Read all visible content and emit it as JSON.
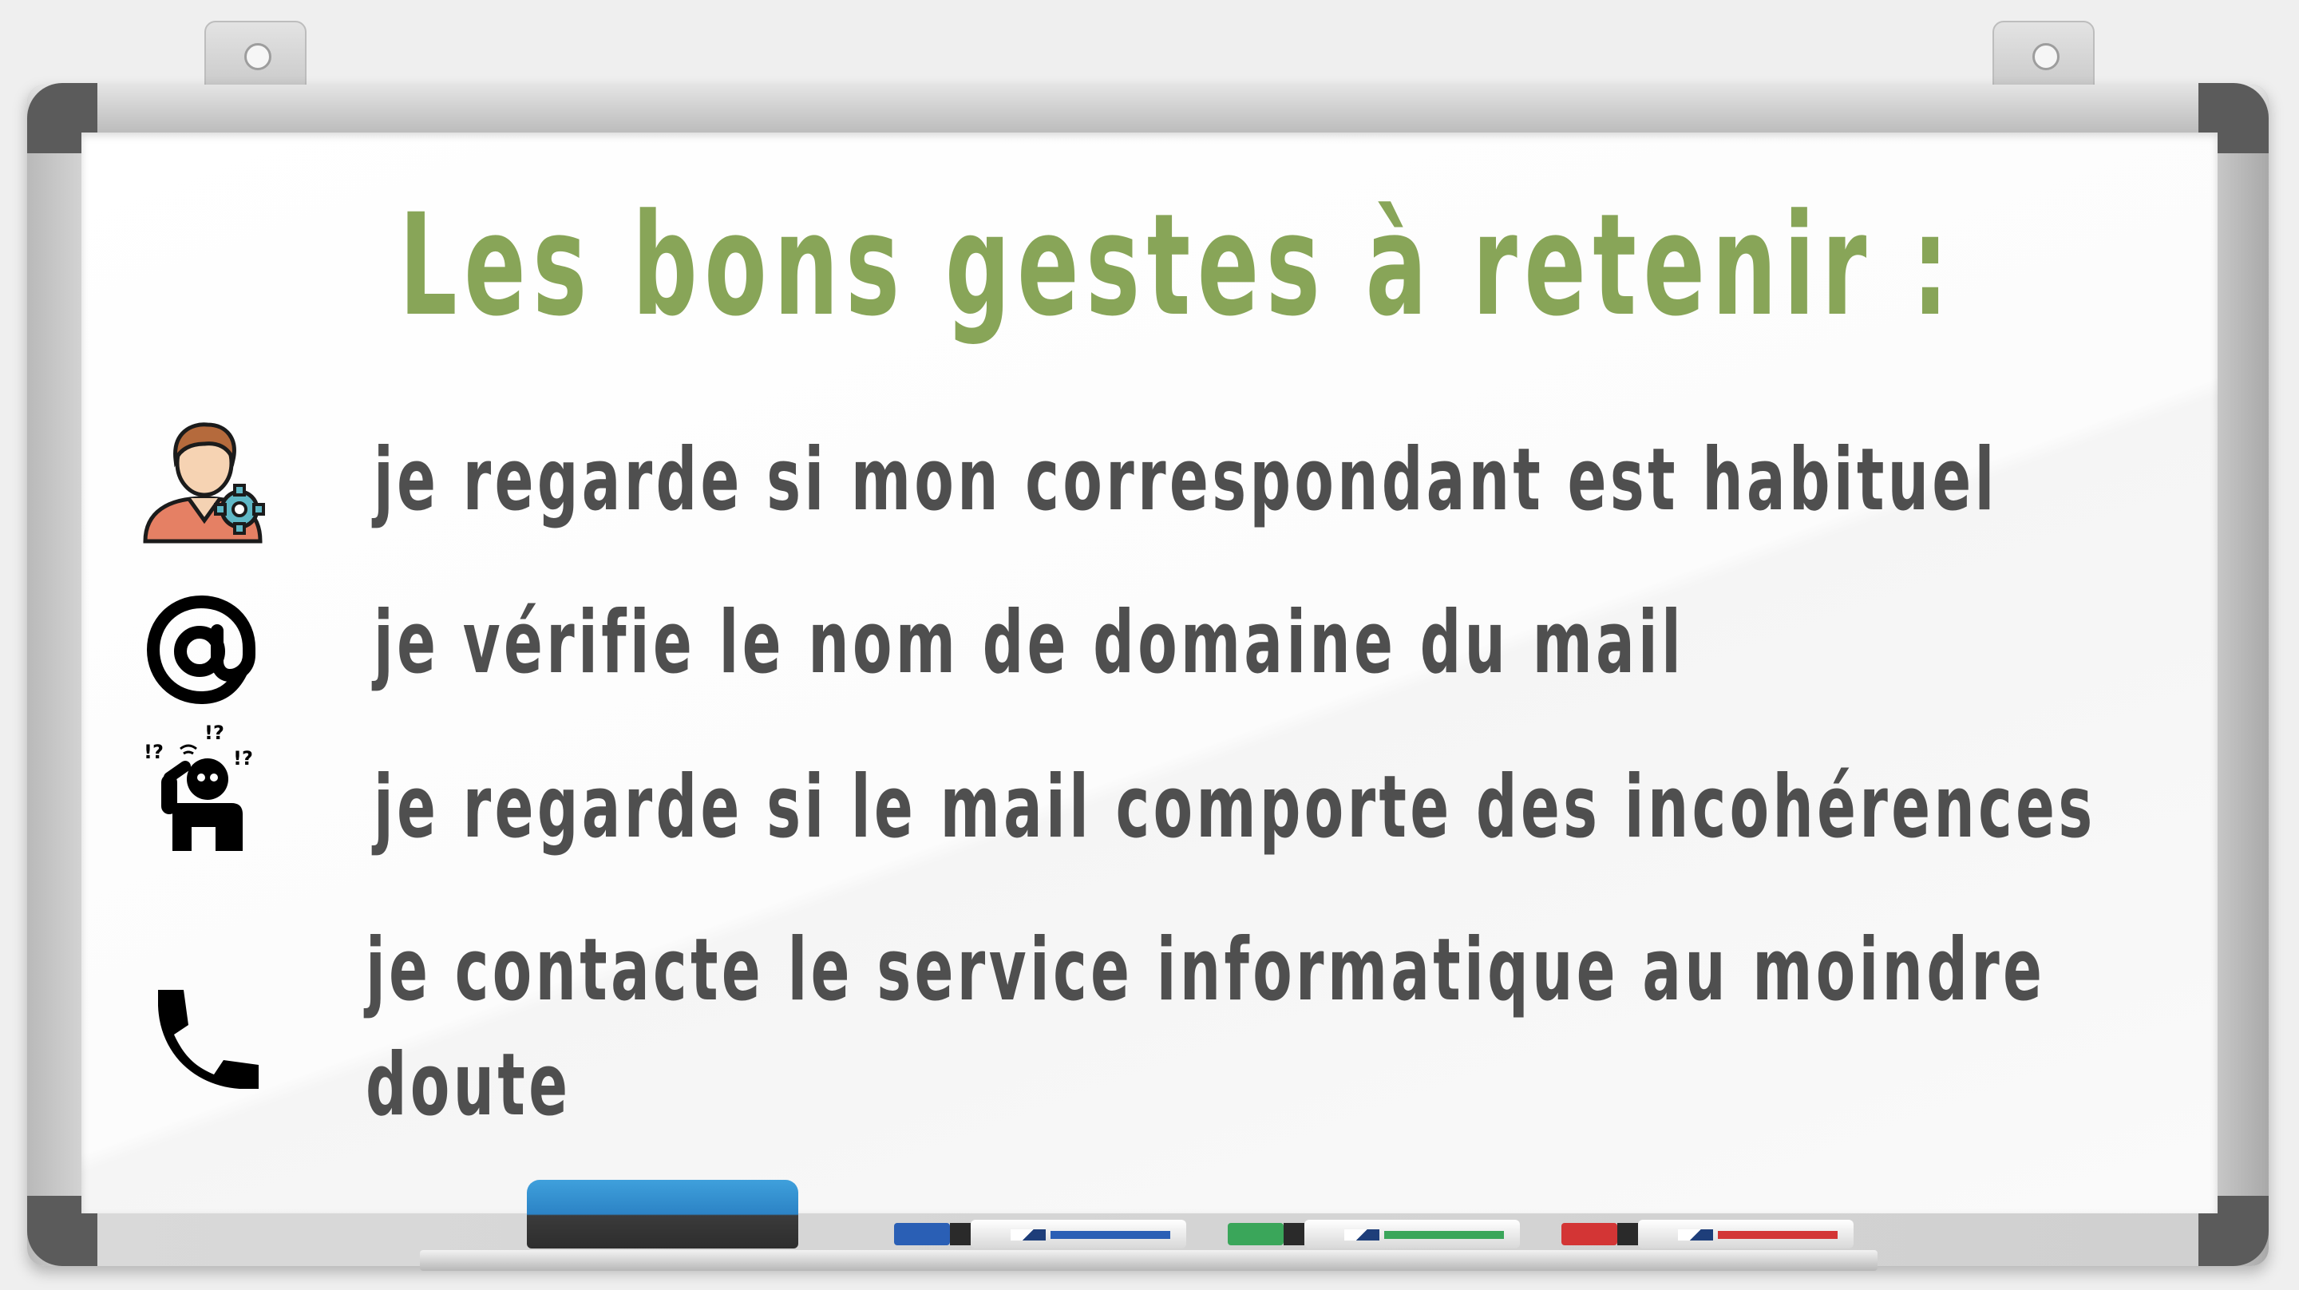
{
  "title": "Les bons gestes à retenir :",
  "items": [
    {
      "icon": "user-gear-icon",
      "text": "je regarde si mon correspondant est habituel"
    },
    {
      "icon": "at-sign-icon",
      "text": "je vérifie le nom de domaine du mail"
    },
    {
      "icon": "confused-person-icon",
      "text": "je regarde si le mail comporte des incohérences"
    },
    {
      "icon": "phone-icon",
      "text": "je contacte le service informatique au moindre",
      "text_line2": "doute"
    }
  ],
  "colors": {
    "title": "#88a558",
    "text": "#4f4f4f",
    "eraser": "#2c83c5",
    "marker_blue": "#2a5fb5",
    "marker_green": "#3aa65a",
    "marker_red": "#d33535"
  }
}
